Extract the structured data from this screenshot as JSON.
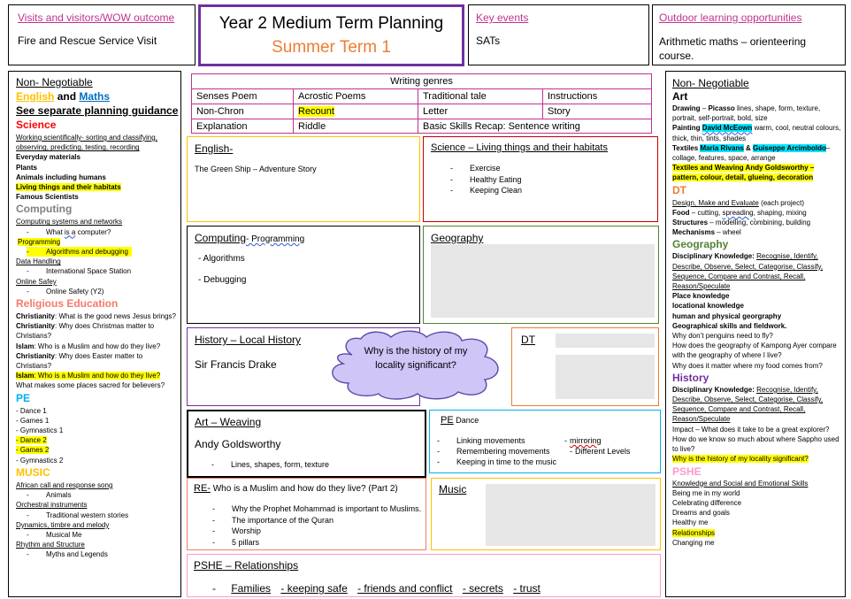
{
  "top": {
    "visitors": {
      "title": "Visits and visitors/WOW outcome",
      "body": "Fire and Rescue Service Visit"
    },
    "title": {
      "line1": "Year 2 Medium Term Planning",
      "line2": "Summer Term 1"
    },
    "key_events": {
      "title": "Key events",
      "body": "SATs"
    },
    "outdoor": {
      "title": "Outdoor learning opportunities",
      "body": "Arithmetic maths – orienteering course."
    }
  },
  "left": {
    "heading": "Non- Negotiable",
    "english": "English",
    "and": "and",
    "maths": "Maths",
    "see_separate": "See separate planning guidance",
    "science": "Science",
    "sci_working": "Working scientifically- sorting and classifying, observing, predicting, testing, recording",
    "sci_items": [
      "Everyday materials",
      "Plants",
      "Animals including humans"
    ],
    "sci_living": "Living things and their habitats",
    "sci_famous": "Famous Scientists",
    "computing": "Computing",
    "comp_systems": "Computing systems and networks",
    "comp_what_a": "What ",
    "comp_what_b": "is  a",
    "comp_what_c": " computer?",
    "comp_programming": "Programming",
    "comp_algorithms": "Algorithms and debugging",
    "comp_data": "Data Handling",
    "comp_iss": "International Space Station",
    "comp_online": "Online Safey",
    "comp_online_y2": "Online Safety (Y2)",
    "re": "Religious Education",
    "re_items": [
      {
        "b": "Christianity",
        "t": ": What is the good news Jesus brings?"
      },
      {
        "b": "Christianity",
        "t": ": Why does Christmas matter to Christians?"
      },
      {
        "b": "Islam",
        "t": ": Who is a Muslim and how do they live?"
      },
      {
        "b": "Christianity",
        "t": ": Why does Easter matter to Christians?"
      }
    ],
    "re_islam_hl_b": "Islam",
    "re_islam_hl_t": ": Who is a Muslim and how do they live?",
    "re_places": "What makes some places sacred for believers?",
    "pe": "PE",
    "pe_items": [
      "- Dance 1",
      "- Games 1",
      "- Gymnastics 1"
    ],
    "pe_items_hl": [
      "- Dance 2",
      "- Games 2"
    ],
    "pe_gym2": "- Gymnastics 2",
    "music": "MUSIC",
    "music_items": [
      {
        "h": "African call and response song",
        "s": "Animals"
      },
      {
        "h": "Orchestral instruments",
        "s": "Traditional western stories"
      },
      {
        "h": "Dynamics, timbre and melody",
        "s": "Musical Me"
      },
      {
        "h": "Rhythm and Structure",
        "s": "Myths and Legends"
      }
    ]
  },
  "genres": {
    "title": "Writing genres",
    "rows": [
      [
        "Senses Poem",
        "Acrostic Poems",
        "Traditional tale",
        "Instructions"
      ],
      [
        "Non-Chron",
        "Recount",
        "Letter",
        "Story"
      ],
      [
        "Explanation",
        "Riddle",
        "Basic Skills Recap: Sentence writing",
        ""
      ]
    ]
  },
  "english": {
    "title": "English-",
    "body": "The Green Ship – Adventure Story"
  },
  "science_box": {
    "title": "Science – Living things and their habitats",
    "items": [
      "Exercise",
      "Healthy Eating",
      "Keeping Clean"
    ]
  },
  "computing_box": {
    "title_a": "Computing",
    "title_b": "- Programming",
    "items": [
      "- Algorithms",
      "- Debugging"
    ]
  },
  "geography": {
    "title": "Geography"
  },
  "history_box": {
    "title": "History – Local History",
    "body": "Sir Francis Drake"
  },
  "cloud": {
    "text": "Why is the history of my locality significant?"
  },
  "dt_box": {
    "title": "DT"
  },
  "art_box": {
    "title": "Art – Weaving",
    "artist": "Andy Goldsworthy",
    "item": "Lines, shapes, form, texture"
  },
  "pe_box": {
    "title": "PE",
    "sub": " Dance",
    "rows": [
      [
        "Linking movements",
        "mirroring"
      ],
      [
        "Remembering movements",
        "Different Levels"
      ],
      [
        "Keeping in time to the music",
        ""
      ]
    ]
  },
  "re_box": {
    "title": "RE-",
    "sub": " Who is a Muslim and how do they live? (Part 2)",
    "items": [
      "Why the Prophet Mohammad is important to Muslims.",
      "The importance of the Quran",
      "Worship",
      "5 pillars"
    ]
  },
  "music_box": {
    "title": "Music"
  },
  "pshe_box": {
    "title": "PSHE",
    "sub": " –  Relationships",
    "items": [
      "Families",
      "- keeping safe",
      "- friends and conflict",
      "- secrets",
      "- trust"
    ]
  },
  "right": {
    "heading": "Non- Negotiable",
    "art": "Art",
    "drawing": {
      "b": "Drawing",
      "a": " – ",
      "name": "Picasso",
      "t": " lines, shape, form, texture, portrait, self-portrait, bold, size"
    },
    "painting": {
      "b": "Painting",
      "name": "David McEown",
      "t": " warm, cool, neutral colours, thick, thin, tints, shades"
    },
    "textiles": {
      "b": "Textiles",
      "name1": "Maria Rivans",
      "amp": " & ",
      "name2": "Guiseppe Arcimboldo",
      "t": "– collage, features, space, arrange"
    },
    "weaving": "Textiles and Weaving Andy Goldsworthy – pattern, colour, detail, glueing, decoration",
    "dt": "DT",
    "dt_design": "Design, Make and Evaluate",
    "dt_design_t": " (each project)",
    "dt_food": {
      "b": "Food",
      "t1": " – cutting, ",
      "s": "spreading,",
      "t2": " shaping, mixing"
    },
    "dt_structures": {
      "b": "Structures",
      "t": " – modelling, combining, building"
    },
    "dt_mech": {
      "b": "Mechanisms",
      "t": " – wheel"
    },
    "geography": "Geography",
    "geo_disc_b": "Disciplinary Knowledge: ",
    "geo_disc_t": "Recognise, Identify, Describe, Observe, Select, Categorise, Classify, Sequence, Compare and Contrast, Recall, Reason/Speculate",
    "geo_bold": [
      "Place knowledge",
      "locational knowledge",
      "human and physical georgraphy",
      "Geographical skills and fieldwork."
    ],
    "geo_q": [
      "Why don’t penguins need to fly?",
      "How does the geography of Kampong Ayer compare with the geography of where I live?",
      "Why does it matter where my food comes from?"
    ],
    "history": "History",
    "his_disc_b": "Disciplinary Knowledge: ",
    "his_disc_t": "Recognise, Identify, Describe, Observe, Select, Categorise, Classify, Sequence, Compare and Contrast, Recall, Reason/Speculate",
    "his_q": [
      "Impact – What does it take to be a great explorer?",
      "How do we know so much about where Sappho used to live?"
    ],
    "his_hl": "Why is the history of my locality significant?",
    "pshe": "PSHE",
    "pshe_ks": "Knowledge and Social and Emotional Skills",
    "pshe_items": [
      "Being me in my world",
      "Celebrating difference",
      "Dreams and goals",
      "Healthy me"
    ],
    "pshe_rel": "Relationships",
    "pshe_change": "Changing me"
  },
  "colors": {
    "title_border": "#7030a0",
    "orange": "#ed7d31",
    "pink": "#c0328f",
    "english": "#ffc000",
    "maths": "#0070c0",
    "science": "#ff0000",
    "re": "#f4796b",
    "pe": "#00b0f0",
    "music": "#ffc000",
    "geo": "#548235",
    "history": "#7030a0",
    "pshe": "#ff99cc"
  }
}
